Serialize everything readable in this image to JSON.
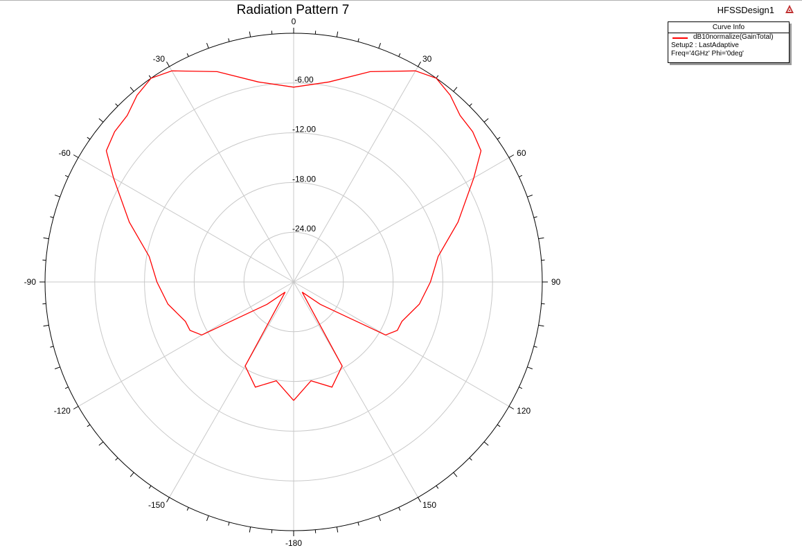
{
  "header": {
    "title": "Radiation Pattern 7",
    "design_name": "HFSSDesign1"
  },
  "legend": {
    "title": "Curve Info",
    "series_name": "dB10normalize(GainTotal)",
    "setup": "Setup2 : LastAdaptive",
    "sweep": "Freq='4GHz' Phi='0deg'"
  },
  "chart_data": {
    "type": "line",
    "subtype": "polar",
    "title": "Radiation Pattern 7",
    "angle_ticks": [
      0,
      30,
      60,
      90,
      120,
      150,
      -180,
      -150,
      -120,
      -90,
      -60,
      -30
    ],
    "angle_tick_labels": [
      "0",
      "30",
      "60",
      "90",
      "120",
      "150",
      "-180",
      "-150",
      "-120",
      "-90",
      "-60",
      "-30"
    ],
    "radial_ticks": [
      -6,
      -12,
      -18,
      -24
    ],
    "radial_tick_labels": [
      "-6.00",
      "-12.00",
      "-18.00",
      "-24.00"
    ],
    "rlim": [
      -30,
      0
    ],
    "grid": true,
    "legend_position": "top-right",
    "colors": {
      "series": "#ff0000",
      "grid": "#c8c8c8",
      "axis": "#000000"
    },
    "series": [
      {
        "name": "dB10normalize(GainTotal)",
        "theta": [
          -180,
          -170,
          -160,
          -150,
          -140,
          -130,
          -120,
          -115,
          -110,
          -100,
          -90,
          -80,
          -70,
          -60,
          -55,
          -50,
          -45,
          -40,
          -35,
          -30,
          -20,
          -10,
          0,
          10,
          20,
          30,
          35,
          40,
          45,
          50,
          55,
          60,
          70,
          80,
          90,
          100,
          110,
          115,
          120,
          130,
          140,
          150,
          160,
          170,
          180
        ],
        "values": [
          -15.7,
          -17.9,
          -16.5,
          -18.3,
          -28.4,
          -25.8,
          -17.2,
          -16.2,
          -16.1,
          -14.6,
          -13.5,
          -12.3,
          -8.9,
          -4.9,
          -2.4,
          -1.8,
          -1.6,
          -0.6,
          0.0,
          -0.6,
          -3.0,
          -5.5,
          -6.5,
          -5.5,
          -3.0,
          -0.6,
          0.0,
          -0.6,
          -1.6,
          -1.8,
          -2.4,
          -4.9,
          -8.9,
          -12.3,
          -13.5,
          -14.6,
          -16.1,
          -16.2,
          -17.2,
          -25.8,
          -28.4,
          -18.3,
          -16.5,
          -17.9,
          -15.7
        ]
      }
    ]
  }
}
